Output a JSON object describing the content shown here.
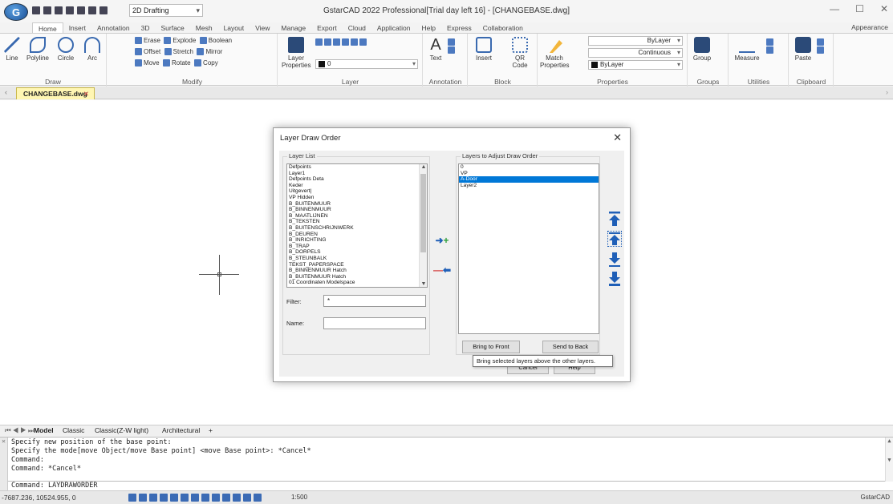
{
  "app": {
    "logo_letter": "G",
    "workspace": "2D Drafting",
    "title": "GstarCAD 2022 Professional[Trial day left 16] - [CHANGEBASE.dwg]",
    "appearance": "Appearance",
    "window_controls": [
      "—",
      "☐",
      "✕"
    ]
  },
  "ribbon": {
    "tabs": [
      "Home",
      "Insert",
      "Annotation",
      "3D",
      "Surface",
      "Mesh",
      "Layout",
      "View",
      "Manage",
      "Export",
      "Cloud",
      "Application",
      "Help",
      "Express",
      "Collaboration"
    ],
    "active_tab": 0,
    "draw": {
      "label": "Draw",
      "tools": [
        "Line",
        "Polyline",
        "Circle",
        "Arc"
      ]
    },
    "modify": {
      "label": "Modify",
      "row1": [
        "Erase",
        "Explode",
        "Boolean"
      ],
      "row2": [
        "Offset",
        "Stretch",
        "Mirror"
      ],
      "row3": [
        "Move",
        "Rotate",
        "Copy"
      ]
    },
    "layer": {
      "label": "Layer",
      "props": "Layer\nProperties",
      "current": "0"
    },
    "annotation": {
      "label": "Annotation",
      "text": "Text"
    },
    "block": {
      "label": "Block",
      "insert": "Insert",
      "qr": "QR\nCode"
    },
    "properties": {
      "label": "Properties",
      "match": "Match\nProperties",
      "color": "ByLayer",
      "linetype": "Continuous",
      "lineweight": "ByLayer"
    },
    "groups": {
      "label": "Groups",
      "group": "Group"
    },
    "utilities": {
      "label": "Utilities",
      "measure": "Measure"
    },
    "clipboard": {
      "label": "Clipboard",
      "paste": "Paste"
    }
  },
  "document": {
    "tab": "CHANGEBASE.dwg"
  },
  "layout_tabs": [
    "Model",
    "Classic",
    "Classic(Z-W light)",
    "Architectural",
    "+"
  ],
  "command": {
    "history": [
      "Specify new position of the base point:",
      "Specify the mode[move Object/move Base point] <move Base point>: *Cancel*",
      "Command:",
      "Command: *Cancel*"
    ],
    "input": "Command: LAYDRAWORDER"
  },
  "status": {
    "coords": "-7687.236, 10524.955, 0",
    "scale": "1:500",
    "app": "GstarCAD"
  },
  "dialog": {
    "title": "Layer Draw Order",
    "layer_list_label": "Layer List",
    "layer_list": [
      "Defpoints",
      "Layer1",
      "Defpoints Deta",
      "Keder",
      "Uitgevert|",
      "VP Hidden",
      "B_BUITENMUUR",
      "B_BINNENMUUR",
      "B_MAATLIJNEN",
      "B_TEKSTEN",
      "B_BUITENSCHRIJNWERK",
      "B_DEUREN",
      "B_INRICHTING",
      "B_TRAP",
      "B_DORPELS",
      "B_STEUNBALK",
      "TEKST_PAPERSPACE",
      "B_BINNENMUUR Hatch",
      "B_BUITENMUUR Hatch",
      "01 Coordinaten Modelspace"
    ],
    "adjust_label": "Layers to Adjust Draw Order",
    "adjust_list": [
      "0",
      "VP",
      "A-Door",
      "Layer2"
    ],
    "adjust_selected": 2,
    "filter_label": "Filter:",
    "filter_value": "*",
    "name_label": "Name:",
    "name_value": "",
    "bring_to_front": "Bring to Front",
    "send_to_back": "Send to Back",
    "cancel": "Cancel",
    "help": "Help",
    "tooltip": "Bring selected layers above the other layers.",
    "close": "✕"
  },
  "colors": {
    "accent": "#0078d7",
    "icon_blue": "#1f5fb7",
    "add_green": "#2e9e3c",
    "remove_red": "#d23a3a",
    "doc_tab": "#fff6b3"
  }
}
